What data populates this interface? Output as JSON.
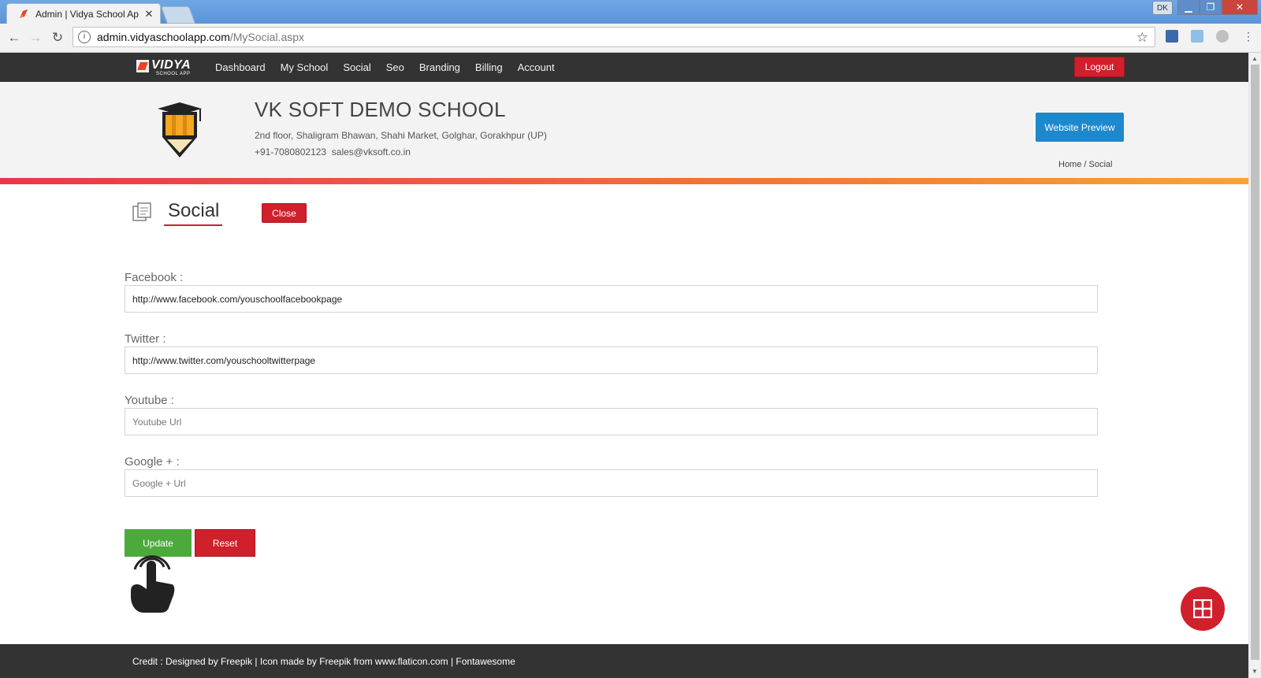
{
  "browser": {
    "tab_title": "Admin | Vidya School Ap",
    "tab_close": "✕",
    "user_badge": "DK",
    "url_host": "admin.vidyaschoolapp.com",
    "url_path": "/MySocial.aspx"
  },
  "nav": {
    "logo_word": "VIDYA",
    "logo_sub": "SCHOOL APP",
    "items": [
      "Dashboard",
      "My School",
      "Social",
      "Seo",
      "Branding",
      "Billing",
      "Account"
    ],
    "logout_label": "Logout"
  },
  "header": {
    "school_name": "VK SOFT DEMO SCHOOL",
    "address": "2nd floor, Shaligram Bhawan, Shahi Market, Golghar, Gorakhpur (UP)",
    "phone": "+91-7080802123",
    "email": "sales@vksoft.co.in",
    "preview_label": "Website Preview",
    "breadcrumb": "Home / Social"
  },
  "page": {
    "title": "Social",
    "close_label": "Close"
  },
  "form": {
    "facebook": {
      "label": "Facebook :",
      "value": "http://www.facebook.com/youschoolfacebookpage",
      "placeholder": ""
    },
    "twitter": {
      "label": "Twitter :",
      "value": "http://www.twitter.com/youschooltwitterpage",
      "placeholder": ""
    },
    "youtube": {
      "label": "Youtube :",
      "value": "",
      "placeholder": "Youtube Url"
    },
    "google": {
      "label": "Google + :",
      "value": "",
      "placeholder": "Google + Url"
    },
    "update_label": "Update",
    "reset_label": "Reset"
  },
  "footer": {
    "credit": "Credit : Designed by Freepik | Icon made by Freepik from www.flaticon.com | Fontawesome"
  },
  "colors": {
    "nav_bg": "#333333",
    "danger": "#d0202b",
    "primary": "#1e88cc",
    "success": "#4caa3c"
  },
  "icons": [
    "info-icon",
    "star-icon",
    "graduation-pencil-icon",
    "social-page-icon",
    "touch-hand-icon",
    "grid-icon"
  ]
}
